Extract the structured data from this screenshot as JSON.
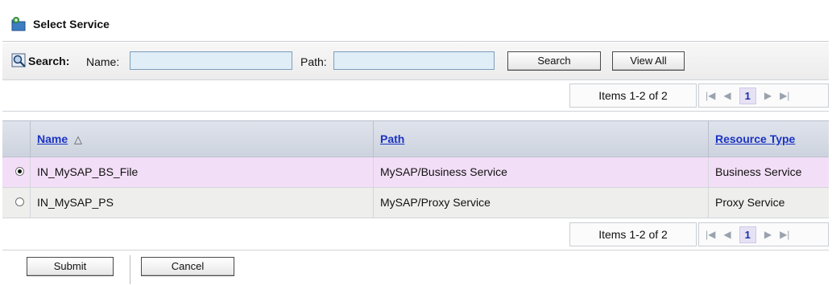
{
  "title": "Select Service",
  "search": {
    "label": "Search:",
    "name_label": "Name:",
    "name_value": "",
    "path_label": "Path:",
    "path_value": "",
    "search_button": "Search",
    "view_all_button": "View All"
  },
  "pager": {
    "items_text": "Items 1-2 of 2",
    "current_page": "1"
  },
  "table": {
    "columns": [
      "Name",
      "Path",
      "Resource Type"
    ],
    "sort_indicator": "△",
    "rows": [
      {
        "name": "IN_MySAP_BS_File",
        "path": "MySAP/Business Service",
        "type": "Business Service",
        "selected": true
      },
      {
        "name": "IN_MySAP_PS",
        "path": "MySAP/Proxy Service",
        "type": "Proxy Service",
        "selected": false
      }
    ]
  },
  "footer": {
    "submit_button": "Submit",
    "cancel_button": "Cancel"
  },
  "colors": {
    "selected_row": "#f3def7",
    "alt_row": "#eeeeec",
    "link": "#1a33c4",
    "header_bg": "#d6dbe5"
  },
  "icons": [
    "service-folder-icon",
    "search-icon",
    "first-page-icon",
    "prev-page-icon",
    "next-page-icon",
    "last-page-icon",
    "radio-selected-icon",
    "radio-unselected-icon",
    "sort-ascending-icon"
  ]
}
